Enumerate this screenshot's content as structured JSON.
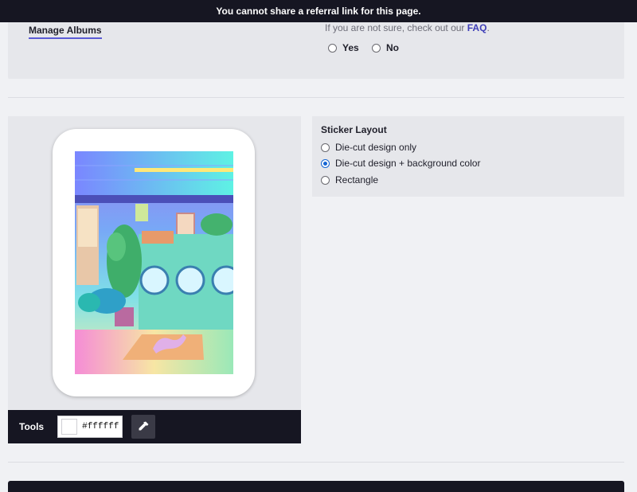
{
  "banner": {
    "text": "You cannot share a referral link for this page."
  },
  "header": {
    "manage_albums": "Manage Albums",
    "faq_prefix": "If you are not sure, check out our ",
    "faq_link": "FAQ",
    "faq_suffix": ".",
    "options": [
      {
        "label": "Yes",
        "selected": false
      },
      {
        "label": "No",
        "selected": false
      }
    ]
  },
  "sticker_layout": {
    "title": "Sticker Layout",
    "options": [
      {
        "label": "Die-cut design only",
        "selected": false
      },
      {
        "label": "Die-cut design + background color",
        "selected": true
      },
      {
        "label": "Rectangle",
        "selected": false
      }
    ]
  },
  "tools": {
    "label": "Tools",
    "color_value": "#ffffff",
    "picker_icon": "eyedropper-icon"
  },
  "colors": {
    "dark": "#161622",
    "panel": "#e6e7eb",
    "page_bg": "#f0f1f4",
    "accent": "#5b5bd6",
    "radio_on": "#1766d2"
  }
}
